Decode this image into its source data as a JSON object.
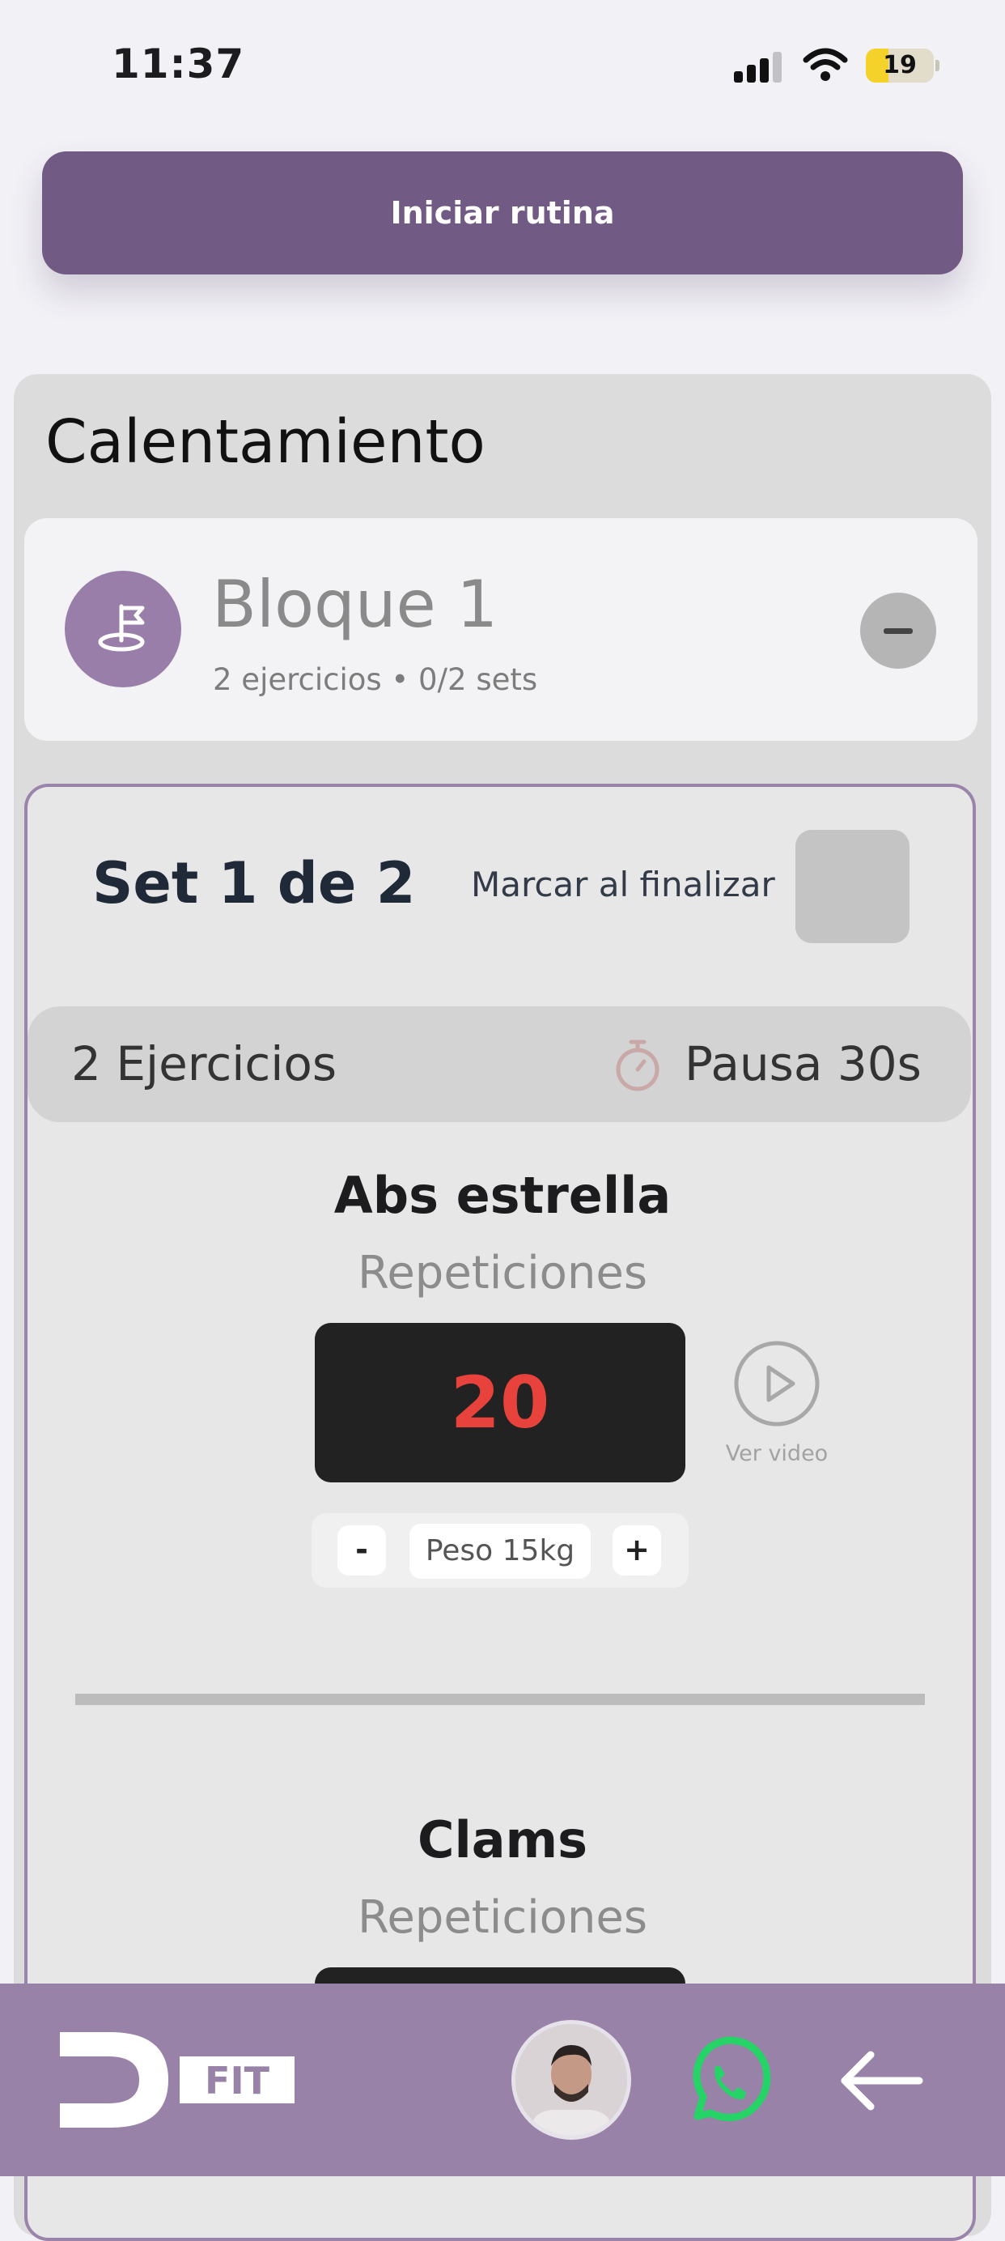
{
  "status_bar": {
    "time": "11:37",
    "battery": "19"
  },
  "routine": {
    "start_label": "Iniciar rutina"
  },
  "section": {
    "title": "Calentamiento"
  },
  "block": {
    "title": "Bloque 1",
    "meta": "2 ejercicios • 0/2 sets"
  },
  "set": {
    "title": "Set 1 de 2",
    "mark_label": "Marcar al finalizar",
    "exercises_count": "2 Ejercicios",
    "pause_label": "Pausa 30s"
  },
  "exercises": [
    {
      "name": "Abs estrella",
      "type": "Repeticiones",
      "reps": "20",
      "video_label": "Ver video",
      "weight_minus": "-",
      "weight_label": "Peso 15kg",
      "weight_plus": "+"
    },
    {
      "name": "Clams",
      "type": "Repeticiones"
    }
  ],
  "bottom_nav": {
    "logo_text": "DFIT"
  },
  "colors": {
    "primary": "#715a83",
    "nav_bar": "#9882a8",
    "reps_text": "#e8423c",
    "whatsapp": "#25d366"
  }
}
